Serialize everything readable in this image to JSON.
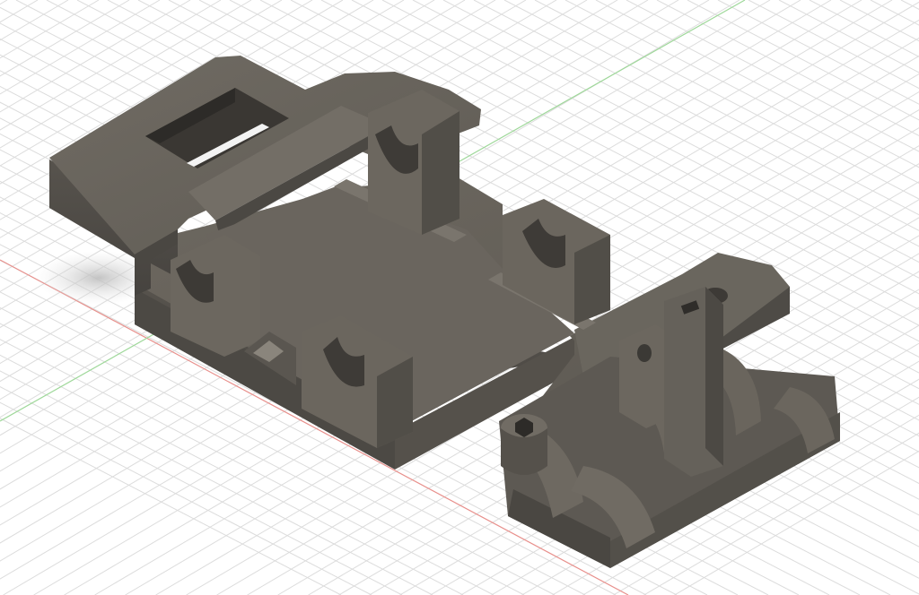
{
  "viewport": {
    "view": "isometric",
    "background_color": "#ffffff",
    "grid_color": "#dcdcdc",
    "x_axis_color": "#e8908c",
    "y_axis_color": "#9fd89a"
  },
  "model": {
    "material_color": "#67635c",
    "parts": [
      "base-plate",
      "rectangular-window-cutout",
      "top-bridge-bar",
      "rod-clips",
      "clip-block",
      "hex-socket",
      "mounting-hole"
    ]
  }
}
